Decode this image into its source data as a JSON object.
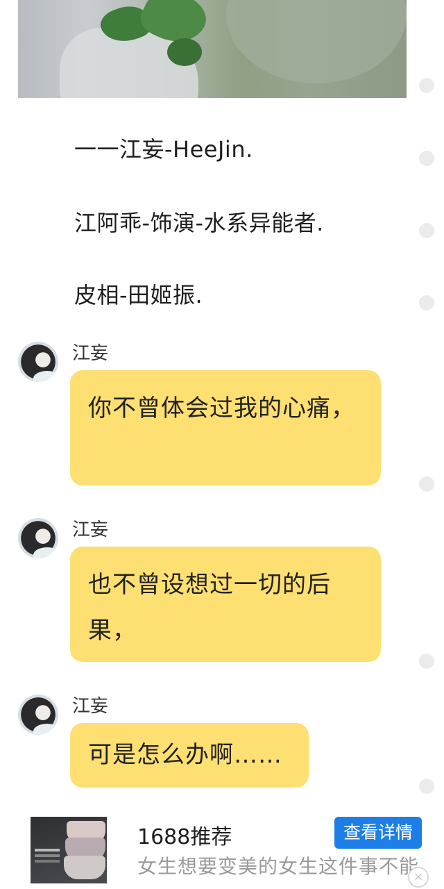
{
  "captions": [
    "一一江妄-HeeJin.",
    "江阿乖-饰演-水系异能者.",
    "皮相-田姬振."
  ],
  "messages": [
    {
      "sender": "江妄",
      "text": "你不曾体会过我的心痛，"
    },
    {
      "sender": "江妄",
      "text": "也不曾设想过一切的后果，"
    },
    {
      "sender": "江妄",
      "text": "可是怎么办啊……"
    }
  ],
  "ad": {
    "title": "1688推荐",
    "description": "女生想要变美的女生这件事不能",
    "button_label": "查看详情",
    "close_glyph": "×"
  },
  "colors": {
    "bubble": "#fedf72",
    "ad_button": "#1e7ee8"
  }
}
